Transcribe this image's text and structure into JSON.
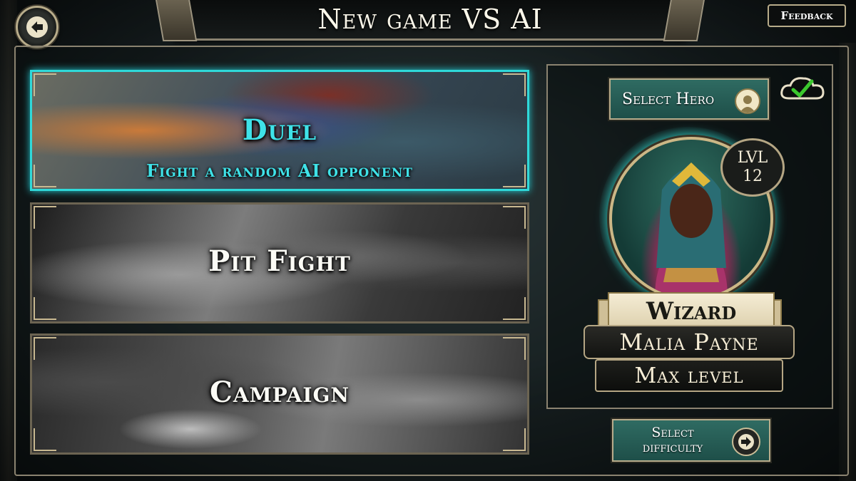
{
  "header": {
    "title": "New game VS AI",
    "back_icon": "arrow-left-icon",
    "feedback_label": "Feedback"
  },
  "modes": [
    {
      "title": "Duel",
      "subtitle": "Fight a random AI opponent",
      "selected": true
    },
    {
      "title": "Pit Fight",
      "subtitle": "",
      "selected": false
    },
    {
      "title": "Campaign",
      "subtitle": "",
      "selected": false
    }
  ],
  "hero_panel": {
    "select_hero_label": "Select Hero",
    "select_hero_icon": "user-icon",
    "sync_icon": "cloud-check-icon",
    "level_label": "LVL",
    "level_value": "12",
    "hero_class": "Wizard",
    "hero_name": "Malia Payne",
    "hero_level_text": "Max level",
    "difficulty_label": "Select\ndifficulty",
    "difficulty_icon": "arrow-right-icon"
  },
  "colors": {
    "accent_cyan": "#3fe2e8",
    "button_teal": "#2f6b62",
    "frame_gold": "#b9ad8c",
    "check_green": "#3cc82e"
  }
}
